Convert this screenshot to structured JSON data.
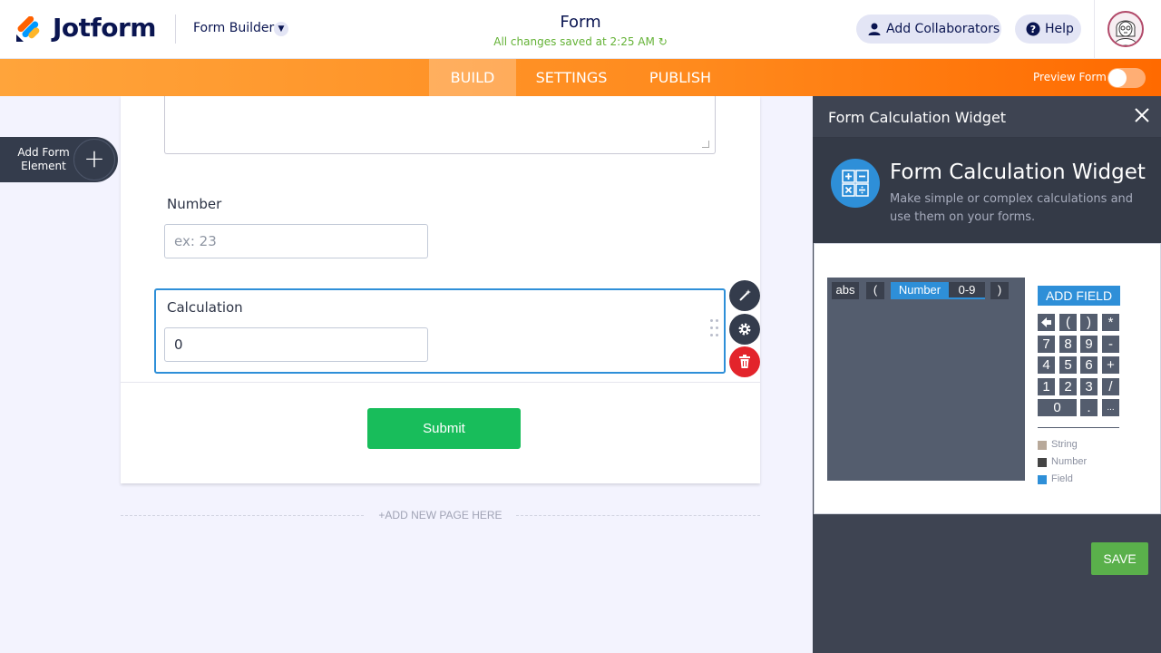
{
  "header": {
    "logo_text": "Jotform",
    "builder_label": "Form Builder",
    "form_title": "Form",
    "save_status": "All changes saved at 2:25 AM",
    "collaborators_label": "Add Collaborators",
    "help_label": "Help"
  },
  "nav": {
    "tabs": [
      {
        "label": "BUILD",
        "active": true
      },
      {
        "label": "SETTINGS",
        "active": false
      },
      {
        "label": "PUBLISH",
        "active": false
      }
    ],
    "preview_label": "Preview Form"
  },
  "sidebar": {
    "add_element_label": "Add Form Element",
    "add_icon": "+"
  },
  "form": {
    "number_label": "Number",
    "number_placeholder": "ex: 23",
    "calculation_label": "Calculation",
    "calculation_value": "0",
    "submit_label": "Submit",
    "add_page_label": "+ADD NEW PAGE HERE"
  },
  "panel": {
    "title": "Form Calculation Widget",
    "widget_name": "Form Calculation Widget",
    "widget_description": "Make simple or complex calculations and use them on your forms.",
    "tokens": [
      {
        "text": "abs",
        "kind": "dark"
      },
      {
        "text": "(",
        "kind": "dark"
      },
      {
        "text": "Number",
        "kind": "field"
      },
      {
        "text": "0-9",
        "kind": "range"
      },
      {
        "text": ")",
        "kind": "dark"
      }
    ],
    "add_field_label": "ADD FIELD",
    "keypad": [
      [
        "←",
        "(",
        ")",
        "*"
      ],
      [
        "7",
        "8",
        "9",
        "-"
      ],
      [
        "4",
        "5",
        "6",
        "+"
      ],
      [
        "1",
        "2",
        "3",
        "/"
      ],
      [
        "0",
        ".",
        "..."
      ]
    ],
    "legend": [
      {
        "label": "String",
        "color": "#b8a99a"
      },
      {
        "label": "Number",
        "color": "#444444"
      },
      {
        "label": "Field",
        "color": "#2e8fd8"
      }
    ],
    "save_label": "SAVE"
  },
  "colors": {
    "accent_orange": "#ff8a1d",
    "accent_blue": "#2e8fd8",
    "submit_green": "#18bd5b",
    "save_green": "#5ab04b",
    "delete_red": "#e3242b"
  }
}
